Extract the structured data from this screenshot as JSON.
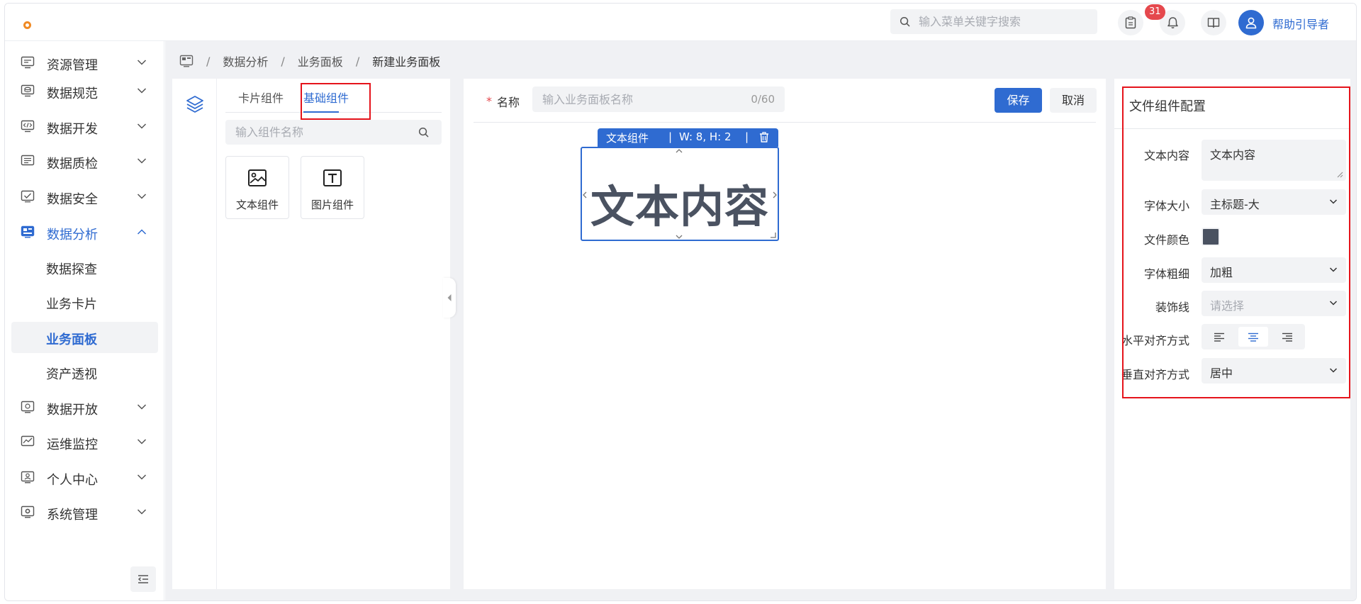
{
  "header": {
    "search_placeholder": "输入菜单关键字搜索",
    "notification_count": "31",
    "user_name": "帮助引导者"
  },
  "sidebar": {
    "items": [
      {
        "label": "资源管理",
        "icon": "server-icon",
        "expanded": false
      },
      {
        "label": "数据规范",
        "icon": "database-icon",
        "expanded": false
      },
      {
        "label": "数据开发",
        "icon": "code-icon",
        "expanded": false
      },
      {
        "label": "数据质检",
        "icon": "doc-check-icon",
        "expanded": false
      },
      {
        "label": "数据安全",
        "icon": "shield-check-icon",
        "expanded": false
      },
      {
        "label": "数据分析",
        "icon": "dashboard-icon",
        "expanded": true
      },
      {
        "label": "数据开放",
        "icon": "open-icon",
        "expanded": false
      },
      {
        "label": "运维监控",
        "icon": "monitor-icon",
        "expanded": false
      },
      {
        "label": "个人中心",
        "icon": "user-card-icon",
        "expanded": false
      },
      {
        "label": "系统管理",
        "icon": "settings-icon",
        "expanded": false
      }
    ],
    "sub_items": [
      {
        "label": "数据探查"
      },
      {
        "label": "业务卡片"
      },
      {
        "label": "业务面板",
        "selected": true
      },
      {
        "label": "资产透视"
      }
    ]
  },
  "breadcrumb": {
    "items": [
      "数据分析",
      "业务面板",
      "新建业务面板"
    ],
    "separator": "/"
  },
  "component_panel": {
    "tabs": [
      {
        "label": "卡片组件",
        "active": false
      },
      {
        "label": "基础组件",
        "active": true
      }
    ],
    "search_placeholder": "输入组件名称",
    "components": [
      {
        "label": "文本组件",
        "icon": "image-text-icon"
      },
      {
        "label": "图片组件",
        "icon": "text-t-icon"
      }
    ]
  },
  "editor": {
    "name_required_mark": "*",
    "name_label": "名称",
    "name_placeholder": "输入业务面板名称",
    "name_counter": "0/60",
    "save_label": "保存",
    "cancel_label": "取消",
    "widget": {
      "title": "文本组件",
      "separator": "|",
      "size": "W: 8, H: 2",
      "content": "文本内容"
    }
  },
  "config_panel": {
    "title": "文件组件配置",
    "fields": {
      "text_content": {
        "label": "文本内容",
        "value": "文本内容"
      },
      "font_size": {
        "label": "字体大小",
        "value": "主标题-大"
      },
      "font_color": {
        "label": "文件颜色",
        "value": "#4a5261"
      },
      "font_weight": {
        "label": "字体粗细",
        "value": "加粗"
      },
      "decoration": {
        "label": "装饰线",
        "placeholder": "请选择"
      },
      "h_align": {
        "label": "水平对齐方式",
        "options": [
          "left",
          "center",
          "right"
        ],
        "selected": "center"
      },
      "v_align": {
        "label": "垂直对齐方式",
        "value": "居中"
      }
    }
  },
  "colors": {
    "primary": "#2f6bd1",
    "highlight_box": "#e5131b",
    "badge": "#e5484d",
    "logo": "#f08a24"
  }
}
